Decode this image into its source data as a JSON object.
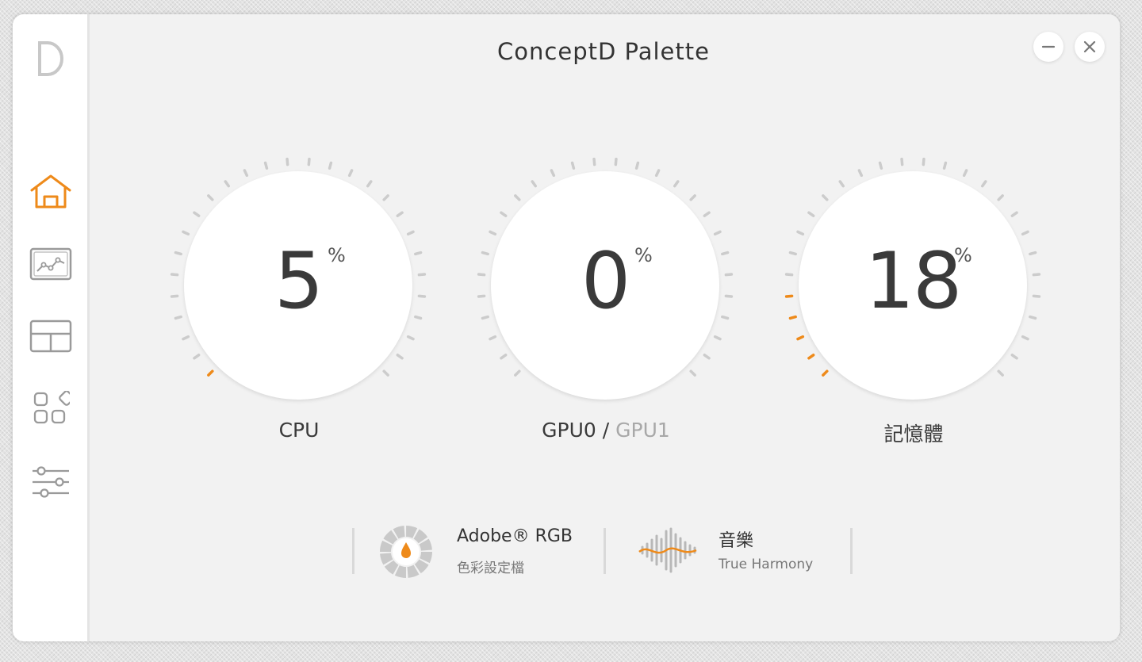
{
  "window": {
    "title": "ConceptD Palette",
    "minimize_icon": "minus-icon",
    "close_icon": "close-icon"
  },
  "sidebar": {
    "logo": "D",
    "items": [
      {
        "name": "home",
        "icon": "home-icon",
        "active": true
      },
      {
        "name": "color",
        "icon": "chart-icon",
        "active": false
      },
      {
        "name": "layout",
        "icon": "layout-icon",
        "active": false
      },
      {
        "name": "apps",
        "icon": "apps-icon",
        "active": false
      },
      {
        "name": "settings",
        "icon": "sliders-icon",
        "active": false
      }
    ]
  },
  "gauges": [
    {
      "label": "CPU",
      "value": "5",
      "unit": "%",
      "percent": 5
    },
    {
      "label": "GPU0",
      "label_secondary": "GPU1",
      "separator": "/",
      "value": "0",
      "unit": "%",
      "percent": 0
    },
    {
      "label": "記憶體",
      "value": "18",
      "unit": "%",
      "percent": 18
    }
  ],
  "profiles": {
    "color": {
      "title": "Adobe® RGB",
      "subtitle": "色彩設定檔",
      "icon": "color-wheel-icon"
    },
    "audio": {
      "title": "音樂",
      "subtitle": "True Harmony",
      "icon": "soundwave-icon"
    }
  },
  "colors": {
    "accent": "#ee8a1a",
    "tick_inactive": "#cccccc",
    "icon_gray": "#9a9a9a"
  }
}
